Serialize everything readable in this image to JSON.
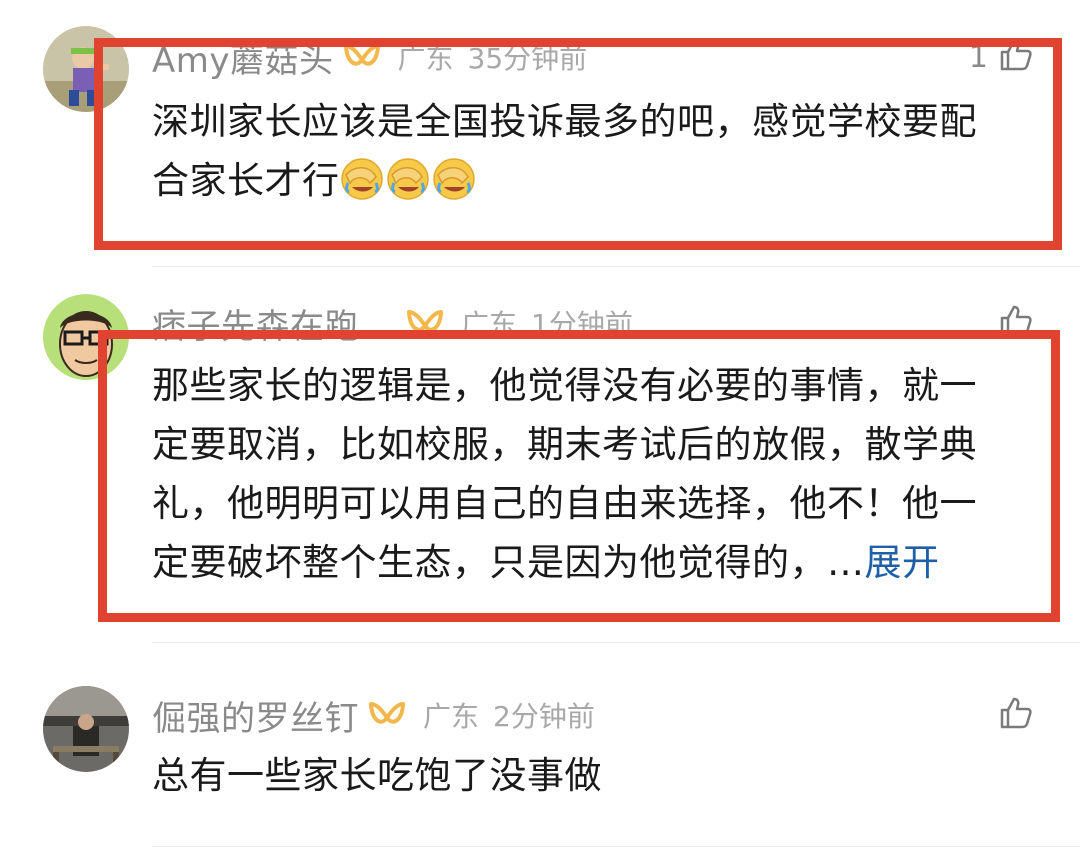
{
  "comments": [
    {
      "username": "Amy蘑菇头",
      "location": "广东",
      "time": "35分钟前",
      "likes": "1",
      "text_lines": [
        "深圳家长应该是全国投诉最多的吧，感觉学校要配",
        "合家长才行"
      ],
      "emojis": [
        "facepalm-laugh-emoji",
        "facepalm-laugh-emoji",
        "facepalm-laugh-emoji"
      ],
      "highlighted": true
    },
    {
      "username": "痞子先森在跑",
      "location": "广东",
      "time": "1分钟前",
      "likes": "",
      "text_lines": [
        "那些家长的逻辑是，他觉得没有必要的事情，就一",
        "定要取消，比如校服，期末考试后的放假，散学典",
        "礼，他明明可以用自己的自由来选择，他不！他一",
        "定要破坏整个生态，只是因为他觉得的，…"
      ],
      "expand_label": "展开",
      "highlighted": true
    },
    {
      "username": "倔强的罗丝钉",
      "location": "广东",
      "time": "2分钟前",
      "likes": "",
      "text_lines": [
        "总有一些家长吃饱了没事做"
      ],
      "highlighted": false
    }
  ],
  "icons": {
    "vip": "vip-badge-icon",
    "like": "thumbs-up-icon"
  },
  "colors": {
    "highlight_border": "#e0432f",
    "username": "#8a8a8a",
    "meta": "#a8a8a8",
    "expand_link": "#1f5fa8",
    "vip_badge": "#f2b84b",
    "emoji": "#f7c948"
  }
}
